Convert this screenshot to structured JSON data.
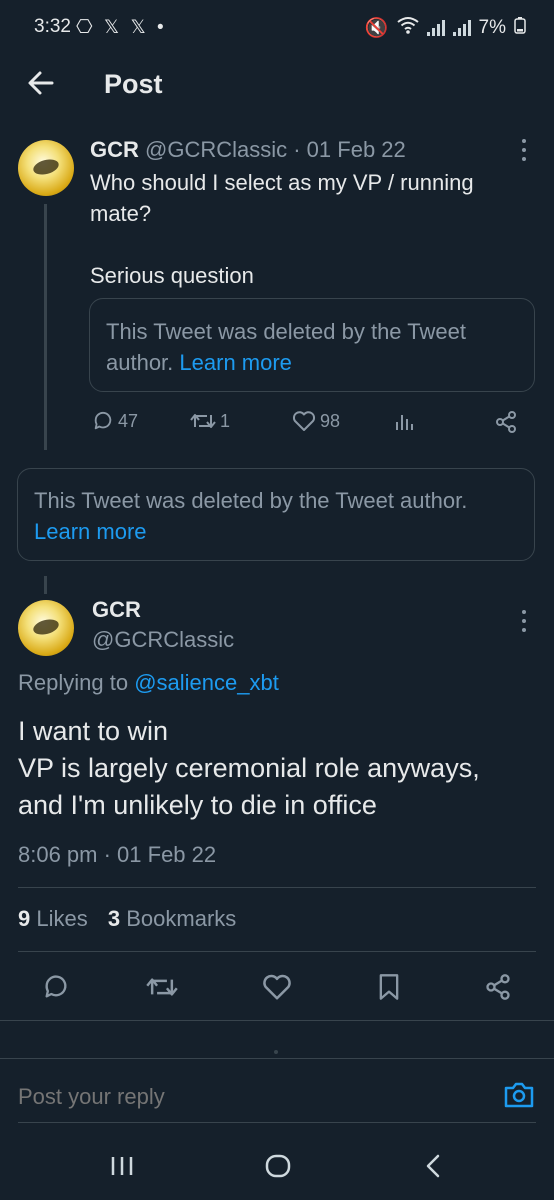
{
  "status_bar": {
    "time": "3:32",
    "left_icons": "⎔ 𝕏 𝕏 •",
    "battery": "7%"
  },
  "header": {
    "title": "Post"
  },
  "parent_tweet": {
    "name": "GCR",
    "handle_date": "@GCRClassic · 01 Feb 22",
    "text_line1": "Who should I select as my VP / running",
    "text_line2": "mate?",
    "text_line3": "Serious question",
    "quoted_deleted_1": "This Tweet was deleted by the Tweet",
    "quoted_deleted_2": "author.",
    "learn_more": "Learn more",
    "replies": "47",
    "retweets": "1",
    "likes": "98"
  },
  "deleted_tweet": {
    "line1": "This Tweet was deleted by the Tweet author.",
    "learn_more": "Learn more"
  },
  "main_tweet": {
    "name": "GCR",
    "handle": "@GCRClassic",
    "replying_prefix": "Replying to",
    "replying_to": "@salience_xbt",
    "line1": "I want to win",
    "line2": "VP is largely ceremonial role anyways,",
    "line3": "and I'm unlikely to die in office",
    "timestamp": "8:06 pm · 01 Feb 22",
    "likes_count": "9",
    "likes_label": "Likes",
    "bookmarks_count": "3",
    "bookmarks_label": "Bookmarks"
  },
  "reply_bar": {
    "placeholder": "Post your reply"
  },
  "colors": {
    "background": "#15202b",
    "accent": "#1d9bf0",
    "muted": "#8b98a5",
    "border": "#38444d"
  }
}
